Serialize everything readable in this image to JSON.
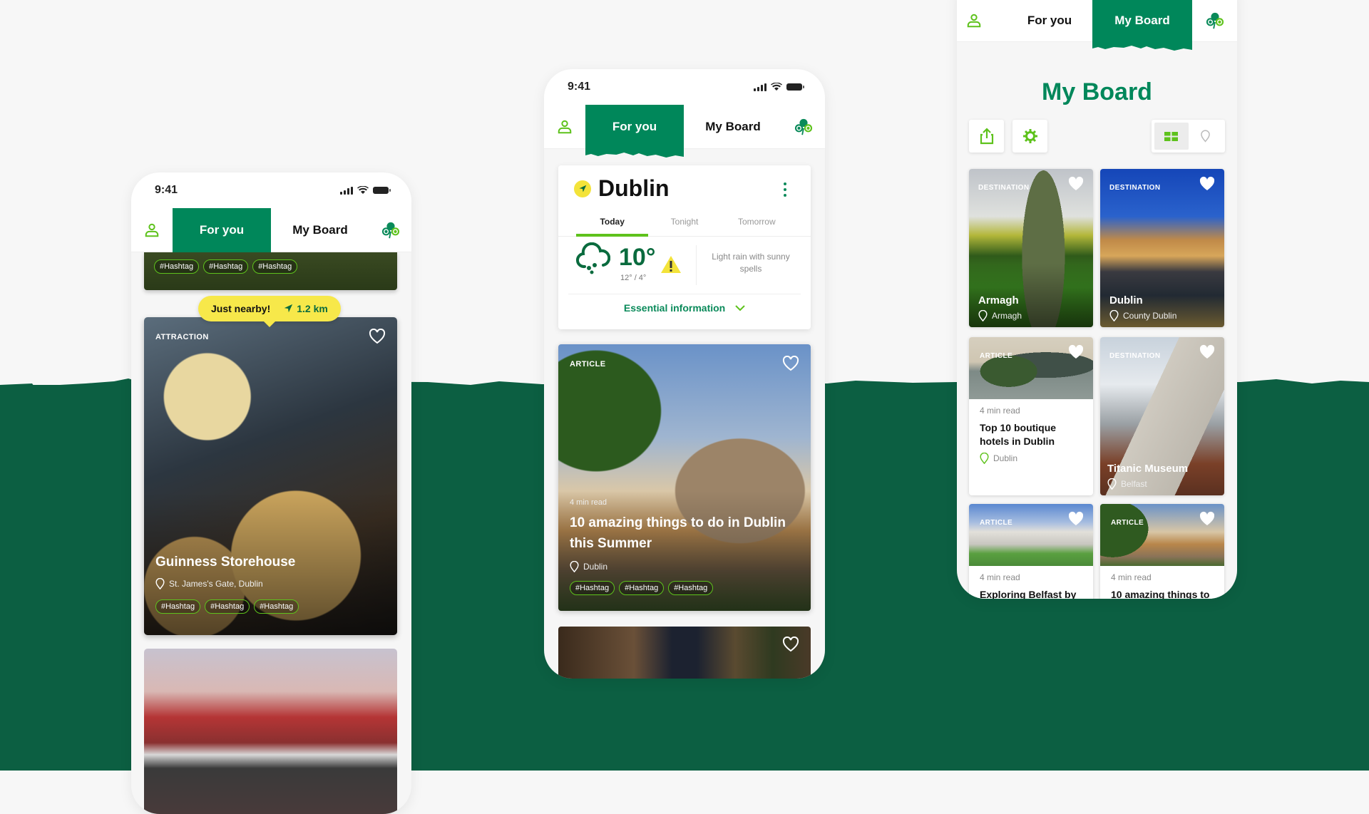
{
  "status_bar": {
    "time": "9:41"
  },
  "nav": {
    "for_you": "For you",
    "my_board": "My Board"
  },
  "left_phone": {
    "peek_tags": [
      "#Hashtag",
      "#Hashtag",
      "#Hashtag"
    ],
    "nearby": {
      "label": "Just nearby!",
      "distance": "1.2 km"
    },
    "feature_card": {
      "category": "ATTRACTION",
      "title": "Guinness Storehouse",
      "location": "St. James's Gate, Dublin",
      "tags": [
        "#Hashtag",
        "#Hashtag",
        "#Hashtag"
      ]
    }
  },
  "middle_phone": {
    "weather": {
      "city": "Dublin",
      "tabs": [
        "Today",
        "Tonight",
        "Tomorrow"
      ],
      "active_tab": "Today",
      "temperature": "10°",
      "range": "12° / 4°",
      "description": "Light rain with sunny spells",
      "essential_info": "Essential information"
    },
    "article_card": {
      "category": "ARTICLE",
      "read_time": "4 min read",
      "title": "10 amazing things to do in Dublin this Summer",
      "location": "Dublin",
      "tags": [
        "#Hashtag",
        "#Hashtag",
        "#Hashtag"
      ]
    }
  },
  "right_phone": {
    "title": "My Board",
    "cards": [
      {
        "category": "DESTINATION",
        "title": "Armagh",
        "location": "Armagh"
      },
      {
        "category": "DESTINATION",
        "title": "Dublin",
        "location": "County Dublin"
      },
      {
        "category": "ARTICLE",
        "read_time": "4 min read",
        "title": "Top 10 boutique hotels in Dublin",
        "location": "Dublin"
      },
      {
        "category": "DESTINATION",
        "title": "Titanic Museum",
        "location": "Belfast"
      },
      {
        "category": "ARTICLE",
        "read_time": "4 min read",
        "title": "Exploring Belfast by"
      },
      {
        "category": "ARTICLE",
        "read_time": "4 min read",
        "title": "10 amazing things to"
      }
    ]
  },
  "colors": {
    "brand_green": "#00875a",
    "background_green": "#0c5f42",
    "accent_lime": "#5ec21c",
    "nearby_yellow": "#f7e84a"
  }
}
